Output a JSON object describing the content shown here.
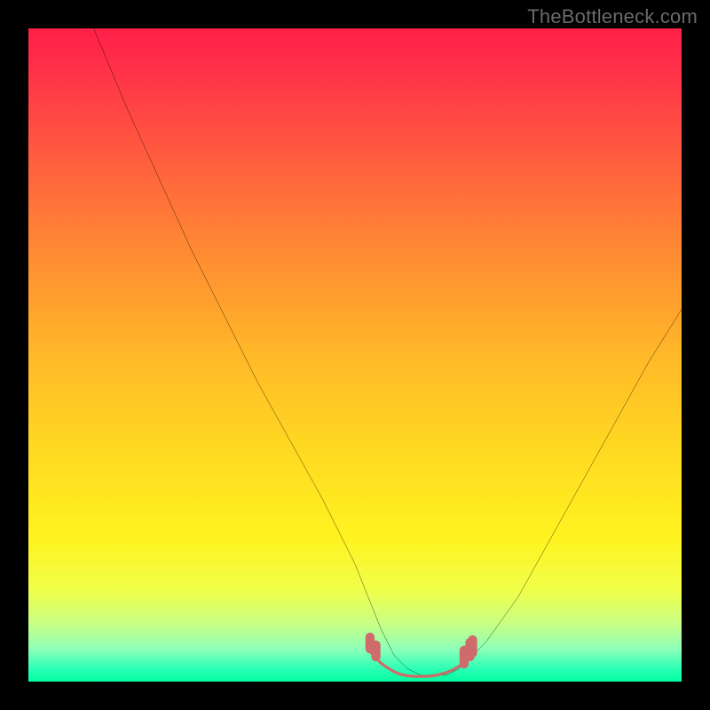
{
  "watermark": {
    "text": "TheBottleneck.com"
  },
  "chart_data": {
    "type": "line",
    "title": "",
    "xlabel": "",
    "ylabel": "",
    "legend": false,
    "grid": false,
    "xlim": [
      0,
      100
    ],
    "ylim": [
      0,
      100
    ],
    "series": [
      {
        "name": "curve",
        "x": [
          10,
          15,
          20,
          25,
          30,
          35,
          40,
          45,
          50,
          52,
          54,
          56,
          58,
          60,
          62,
          64,
          66,
          70,
          75,
          80,
          85,
          90,
          95,
          100
        ],
        "values": [
          100,
          88,
          77,
          66,
          56,
          46,
          37,
          28,
          18,
          13,
          8,
          4,
          2,
          1,
          1,
          1,
          2,
          6,
          13,
          22,
          31,
          40,
          49,
          57
        ]
      }
    ],
    "highlight": {
      "name": "trough-band",
      "x_range": [
        52,
        66
      ],
      "y": 1,
      "color": "#cf6b6b"
    },
    "background": {
      "type": "vertical-gradient",
      "stops": [
        {
          "pct": 0,
          "color": "#ff1f47"
        },
        {
          "pct": 50,
          "color": "#ffb828"
        },
        {
          "pct": 80,
          "color": "#fff31f"
        },
        {
          "pct": 100,
          "color": "#00ffa0"
        }
      ]
    }
  }
}
